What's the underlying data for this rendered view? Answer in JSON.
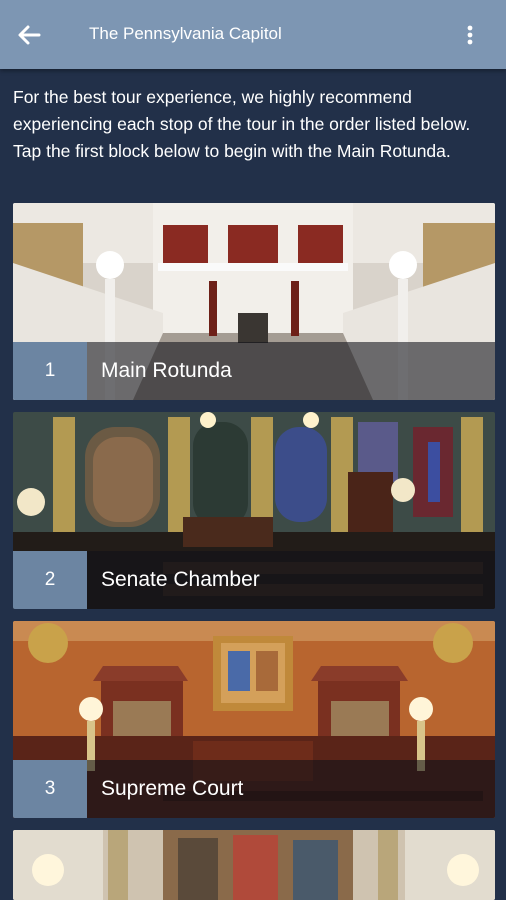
{
  "appbar": {
    "title": "The Pennsylvania Capitol",
    "back_icon": "arrow-left-icon",
    "menu_icon": "more-vert-icon"
  },
  "intro": {
    "text": "For the best tour experience, we highly recommend experiencing each stop of the tour in the order listed below. Tap the first block below to begin with the Main Rotunda."
  },
  "stops": [
    {
      "number": "1",
      "label": "Main Rotunda"
    },
    {
      "number": "2",
      "label": "Senate Chamber"
    },
    {
      "number": "3",
      "label": "Supreme Court"
    }
  ],
  "colors": {
    "appbar": "#7d96b3",
    "background": "#223049",
    "number_box": "#6c85a2"
  }
}
